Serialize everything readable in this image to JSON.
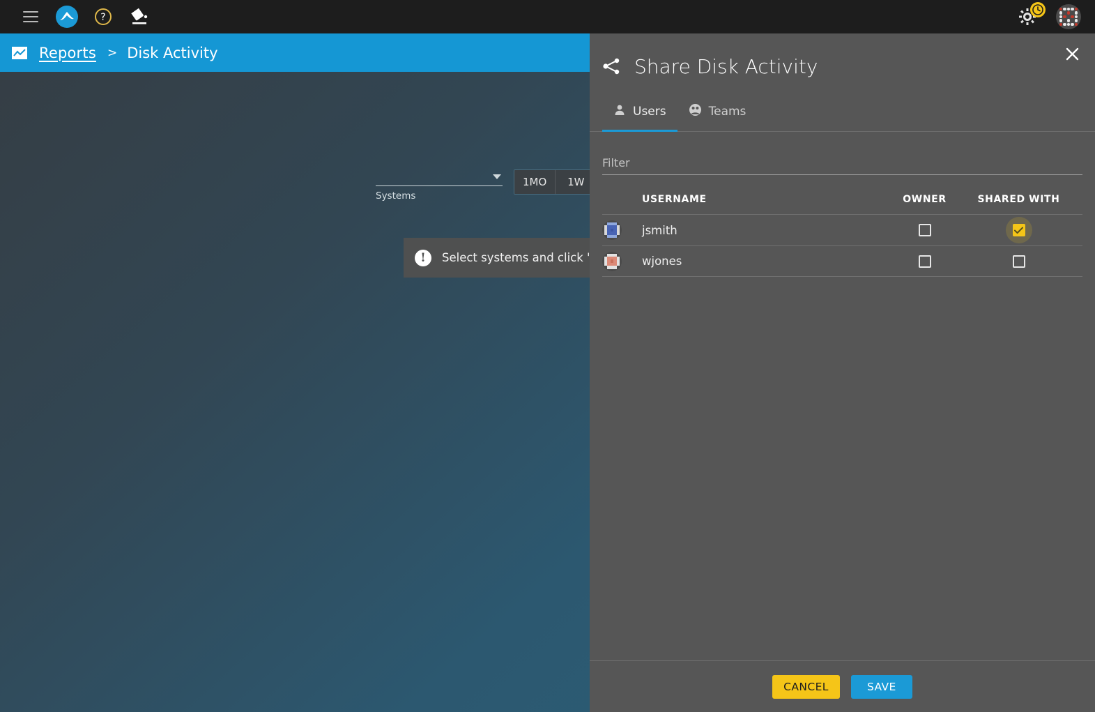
{
  "topbar": {
    "menu_icon": "hamburger-menu-icon",
    "logo_icon": "app-logo-icon",
    "help_icon": "help-circle-icon",
    "theme_icon": "paint-bucket-icon",
    "settings_icon": "gear-icon",
    "settings_badge_icon": "clock-badge-icon",
    "user_avatar_icon": "user-avatar-identicon"
  },
  "breadcrumb": {
    "chart_icon": "report-chart-icon",
    "parent": "Reports",
    "separator": ">",
    "current": "Disk Activity"
  },
  "background_page": {
    "systems_select": {
      "value": "",
      "label": "Systems",
      "caret_icon": "chevron-down-icon"
    },
    "time_ranges": [
      "1MO",
      "1W"
    ],
    "notice": {
      "icon": "exclamation-icon",
      "text": "Select systems and click 'Gener"
    }
  },
  "share_panel": {
    "share_icon": "share-nodes-icon",
    "title": "Share Disk Activity",
    "close_icon": "close-x-icon",
    "tabs": [
      {
        "label": "Users",
        "icon": "person-icon",
        "active": true
      },
      {
        "label": "Teams",
        "icon": "group-circle-icon",
        "active": false
      }
    ],
    "filter": {
      "placeholder": "Filter",
      "value": ""
    },
    "table": {
      "columns": {
        "username": "USERNAME",
        "owner": "OWNER",
        "shared_with": "SHARED WITH"
      },
      "rows": [
        {
          "username": "jsmith",
          "avatar_icon": "identicon-avatar",
          "avatar_color": "#5b79c4",
          "owner": false,
          "shared_with": true
        },
        {
          "username": "wjones",
          "avatar_icon": "identicon-avatar",
          "avatar_color": "#d98070",
          "owner": false,
          "shared_with": false
        }
      ]
    },
    "footer": {
      "cancel": "CANCEL",
      "save": "SAVE"
    }
  },
  "colors": {
    "accent_blue": "#1597d4",
    "accent_yellow": "#f5c518",
    "panel_bg": "#565656",
    "topbar_bg": "#1d1d1d"
  }
}
